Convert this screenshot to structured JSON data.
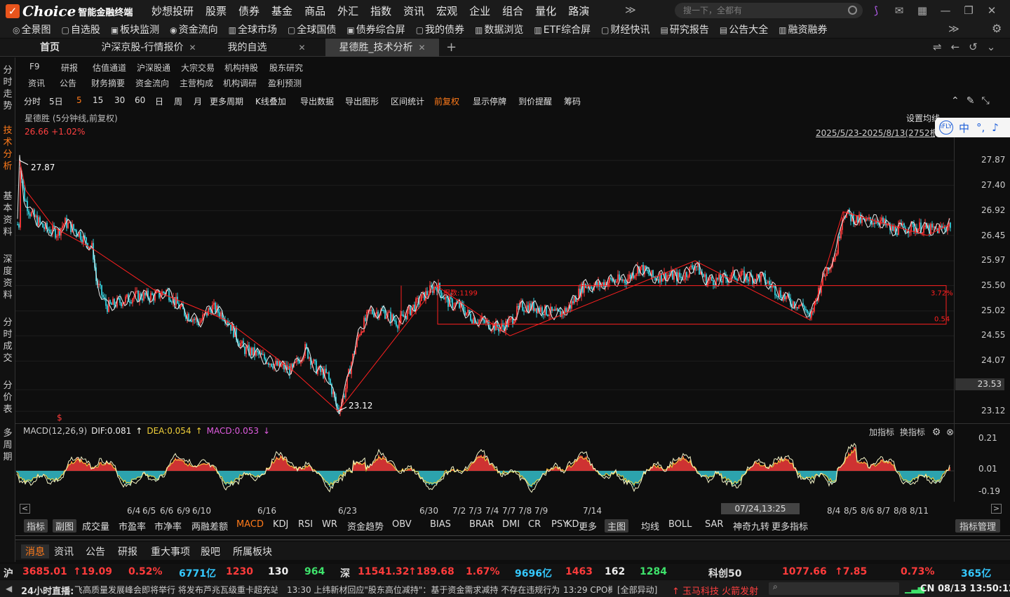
{
  "app": {
    "brand": "Choice",
    "subtitle": "智能金融终端"
  },
  "top_menu": [
    "妙想投研",
    "股票",
    "债券",
    "基金",
    "商品",
    "外汇",
    "指数",
    "资讯",
    "宏观",
    "企业",
    "组合",
    "量化",
    "路演"
  ],
  "search": {
    "placeholder": "搜一下，全都有"
  },
  "toolbar": [
    [
      "◎",
      "全景图"
    ],
    [
      "▢",
      "自选股"
    ],
    [
      "▣",
      "板块监测"
    ],
    [
      "◉",
      "资金流向"
    ],
    [
      "▥",
      "全球市场"
    ],
    [
      "▢",
      "全球国债"
    ],
    [
      "▣",
      "债券综合屏"
    ],
    [
      "▢",
      "我的债券"
    ],
    [
      "▥",
      "数据浏览"
    ],
    [
      "▥",
      "ETF综合屏"
    ],
    [
      "▢",
      "财经快讯"
    ],
    [
      "▤",
      "研究报告"
    ],
    [
      "▤",
      "公告大全"
    ],
    [
      "▥",
      "融资融券"
    ]
  ],
  "tabs": [
    "首页",
    "沪深京股-行情报价",
    "我的自选",
    "星德胜_技术分析"
  ],
  "left_nav": [
    "分时走势",
    "技术分析",
    "基本资料",
    "深度资料",
    "分时成交",
    "分价表",
    "多周期"
  ],
  "f9_row1": [
    "F9",
    "研报",
    "估值通道",
    "沪深股通",
    "大宗交易",
    "机构持股",
    "股东研究"
  ],
  "f9_row2": [
    "资讯",
    "公告",
    "财务摘要",
    "资金流向",
    "主营构成",
    "机构调研",
    "盈利预测"
  ],
  "periods": [
    "分时",
    "5日",
    "5",
    "15",
    "30",
    "60",
    "日",
    "周",
    "月",
    "更多周期",
    "K线叠加",
    "导出数据",
    "导出图形",
    "区间统计",
    "前复权",
    "显示停牌",
    "到价提醒",
    "筹码"
  ],
  "chart": {
    "info": "星德胜 (5分钟线,前复权)",
    "price": "26.66 +1.02%",
    "set_avg": "设置均线",
    "date_range": "2025/5/23-2025/8/13(2752根)",
    "float_tools": [
      "中",
      "°,",
      "♪"
    ],
    "high_label": "27.87",
    "low_label": "23.12",
    "box_label": "根数:1199",
    "box_pct_top": "3.72%",
    "box_pct_bottom": "0.54",
    "current": "23.53",
    "marker": "$"
  },
  "y_labels": [
    "27.87",
    "27.40",
    "26.92",
    "26.45",
    "25.97",
    "25.50",
    "25.02",
    "24.55",
    "24.07",
    "23.53",
    "23.12"
  ],
  "macd": {
    "name": "MACD(12,26,9)",
    "dif": "DIF:0.081",
    "dea": "DEA:0.054",
    "macd": "MACD:0.053",
    "right1": "加指标",
    "right2": "换指标",
    "y": [
      "0.21",
      "0.01",
      "-0.19"
    ]
  },
  "x_labels": [
    "6/4",
    "6/5",
    "6/6",
    "6/9",
    "6/10",
    "6/16",
    "6/23",
    "6/30",
    "7/2",
    "7/3",
    "7/4",
    "7/7",
    "7/8",
    "7/9",
    "7/14",
    "8/4",
    "8/5",
    "8/6",
    "8/7",
    "8/8",
    "8/11"
  ],
  "cursor_time": "07/24,13:25",
  "indicators": [
    "指标",
    "副图",
    "成交量",
    "市盈率",
    "市净率",
    "两融差额",
    "MACD",
    "KDJ",
    "RSI",
    "WR",
    "资金趋势",
    "OBV",
    "BIAS",
    "BRAR",
    "DMI",
    "CR",
    "PSY",
    "KD",
    "更多",
    "主图",
    "均线",
    "BOLL",
    "SAR",
    "神奇九转",
    "更多指标",
    "指标管理"
  ],
  "news_tabs": [
    "消息",
    "资讯",
    "公告",
    "研报",
    "重大事项",
    "股吧",
    "所属板块"
  ],
  "ticker": {
    "sh": "沪",
    "sh_idx": "3685.01",
    "sh_chg": "↑19.09",
    "sh_pct": "0.52%",
    "sh_amt": "6771亿",
    "sh_up": "1230",
    "sh_flat": "130",
    "sh_down": "964",
    "sz": "深",
    "sz_idx": "11541.32",
    "sz_chg": "↑189.68",
    "sz_pct": "1.67%",
    "sz_amt": "9696亿",
    "sz_up": "1463",
    "sz_flat": "162",
    "sz_down": "1284",
    "kc": "科创50",
    "kc_idx": "1077.66",
    "kc_chg": "↑7.85",
    "kc_pct": "0.73%",
    "kc_amt": "365亿"
  },
  "status": {
    "live": "24小时直播:",
    "news1": "飞高质量发展峰会即将举行 将发布芦兆瓦级重卡超充站",
    "news2": "13:30 上纬新材回应\"股东高位减持\"：基于资金需求减持 不存在违规行为",
    "news3": "13:29 CPO概",
    "news4": "[全部异动]",
    "alert": "↑ 玉马科技 火箭发射",
    "clock": "CN 08/13 13:50:12"
  },
  "colors": {
    "up": "#ff3b3b",
    "down": "#35c9d6",
    "dif": "#f4f4c8",
    "dea": "#f2d13a",
    "box": "#ff2020"
  }
}
